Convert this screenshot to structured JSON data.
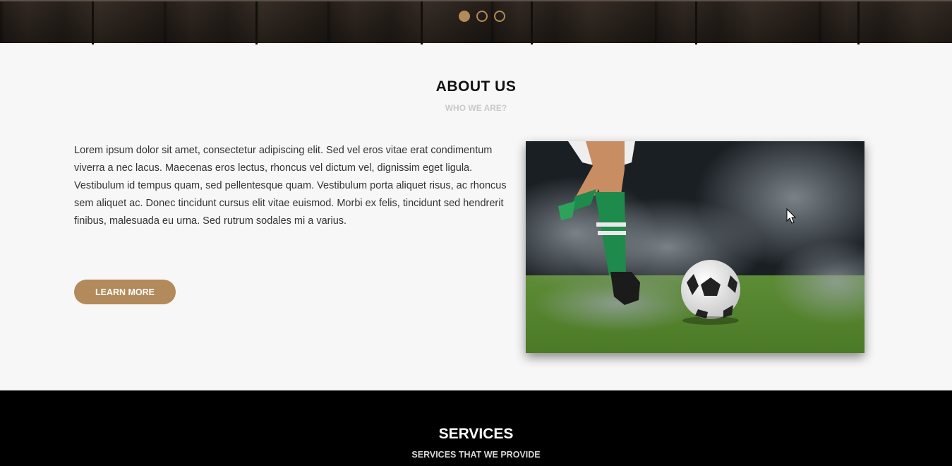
{
  "slider": {
    "dots": [
      {
        "label": "slide-1",
        "active": true
      },
      {
        "label": "slide-2",
        "active": false
      },
      {
        "label": "slide-3",
        "active": false
      }
    ],
    "accent": "#b28a5b"
  },
  "about": {
    "title": "ABOUT US",
    "subtitle": "WHO WE ARE?",
    "body": "Lorem ipsum dolor sit amet, consectetur adipiscing elit. Sed vel eros vitae erat condimentum viverra a nec lacus. Maecenas eros lectus, rhoncus vel dictum vel, dignissim eget ligula. Vestibulum id tempus quam, sed pellentesque quam. Vestibulum porta aliquet risus, ac rhoncus sem aliquet ac. Donec tincidunt cursus elit vitae euismod. Morbi ex felis, tincidunt sed hendrerit finibus, malesuada eu urna. Sed rutrum sodales mi a varius.",
    "button_label": "LEARN MORE",
    "button_color": "#b28a5b"
  },
  "services": {
    "title": "SERVICES",
    "subtitle": "SERVICES THAT WE PROVIDE"
  }
}
